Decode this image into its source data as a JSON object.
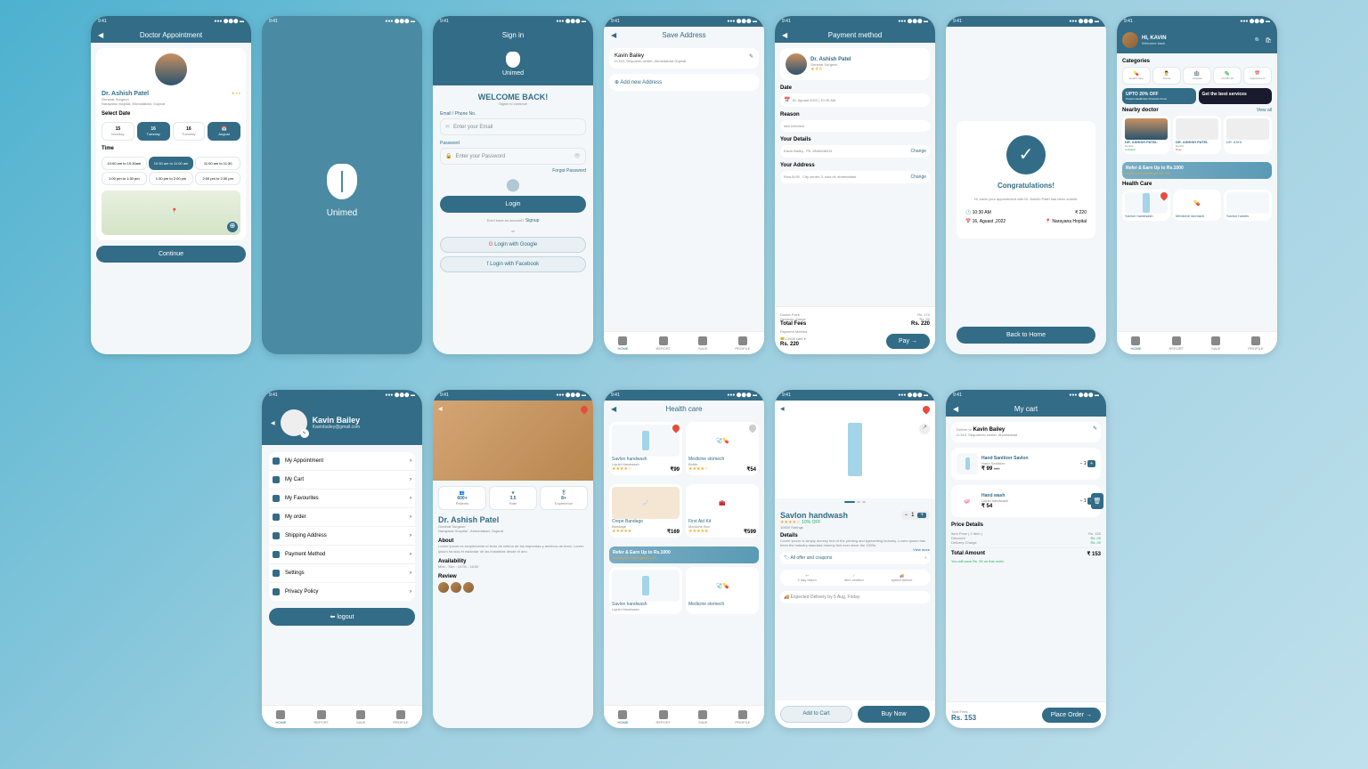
{
  "status": {
    "time": "9:41",
    "sig": "●●● ⬤⬤⬤ ▬"
  },
  "s1": {
    "title": "Doctor Appointment",
    "name": "Dr. Ashish Patel",
    "role": "Genarat Surgeon",
    "loc": "Narayana hospital, Ahmadabad, Gujarat",
    "rate": "★ 4.6",
    "selDate": "Select Date",
    "dates": [
      {
        "d": "15",
        "l": "Monday"
      },
      {
        "d": "16",
        "l": "Tuesday"
      },
      {
        "d": "16",
        "l": "Tuesday"
      },
      {
        "d": "📅",
        "l": "August"
      }
    ],
    "timeLbl": "Time",
    "times": [
      "10:00 am to 10:30am",
      "10:30 am to 11:00 am",
      "11:00 am to 11:30",
      "1:00 pm to 1:30 pm",
      "1:30 pm to 2:00 pm",
      "2:00 pm to 2:30 pm"
    ],
    "cont": "Continue"
  },
  "s2": {
    "brand": "Unimed"
  },
  "s3": {
    "title": "Sign in",
    "brand": "Unimed",
    "welcome": "WELCOME BACK!",
    "sub": "Signin to continue",
    "emailLbl": "Email / Phone No.",
    "emailPh": "Enter your Email",
    "pwLbl": "Password",
    "pwPh": "Enter your Password",
    "forgot": "Forgot Password",
    "login": "Login",
    "noAcc": "Don't have an account?",
    "signup": "Signup",
    "or": "or",
    "google": "Login with Google",
    "fb": "Login with Facebook"
  },
  "s4": {
    "title": "Save Address",
    "name": "Kavin Bailey",
    "addr": "D-310, Sequardo center, Ahmedabad Gujarat",
    "add": "Add new Address"
  },
  "s5": {
    "title": "Payment method",
    "doc": "Dr. Ashish Patel",
    "role": "General Surgeon",
    "dateLbl": "Date",
    "date": "16, Aguast 2022 | 10:30 AM",
    "reasonLbl": "Reason",
    "reason": "skin infection",
    "detLbl": "Your Details",
    "det": "Kavin Bailey , Ph. 8546846231",
    "addrLbl": "Your Address",
    "addr": "Row-B-69 , City center-3, sola rd, ahmedabad",
    "change": "Change",
    "df": "Doctor Fees",
    "dfv": "Rs. 170",
    "sc": "Services charge",
    "scv": "Rs. 50",
    "tf": "Total Fees",
    "tfv": "Rs. 220",
    "pm": "Payment Method",
    "cc": "Credit care",
    "amt": "Rs. 220",
    "pay": "Pay"
  },
  "s6": {
    "cong": "Congratulations!",
    "msg": "Hi, kavin your appointment with Dr. Ashish Patel has been submit.",
    "t1": "10:30 AM",
    "t2": "220",
    "d1": "16, Aguast ,2022",
    "d2": "Narayana Hopital",
    "back": "Back to Home"
  },
  "s7": {
    "hi": "HI, KAVIN",
    "sub": "Welcome back",
    "catLbl": "Categories",
    "cats": [
      "Health Care",
      "Doctor",
      "Hospital",
      "COVID-19",
      "Appointment"
    ],
    "ban1": "UPTO 20% OFF",
    "ban1s": "Protect Healthcare Products Know",
    "ban2": "Get the best services",
    "nearLbl": "Nearby doctor",
    "view": "View all",
    "doc": "DR. ASHISH PATEL",
    "docr": "Dentist",
    "avail": "Available",
    "busy": "Busy",
    "refer": "Refer & Earn Up to Rs.1000",
    "refers": "invite your friend get Rs. 25",
    "hcLbl": "Health Care",
    "p1": "Savlon handwash",
    "p2": "Medicine stomach",
    "p3": "Savlon handw"
  },
  "s8": {
    "name": "Kavin Bailey",
    "email": "Kavinbailey@gmail.com",
    "items": [
      "My Appointment",
      "My Cart",
      "My Favourites",
      "My order",
      "Shipping Address",
      "Payment Method",
      "Settings",
      "Privacy Policy"
    ],
    "logout": "logout"
  },
  "s9": {
    "name": "Dr. Ashish Patel",
    "role": "General Surgeon",
    "loc": "Narayana Hospital , Ahmedabad, Gujarat",
    "st1": "600+",
    "st1l": "Patients",
    "st2": "3.5",
    "st2l": "Rate",
    "st3": "8+",
    "st3l": "Experience",
    "aboutLbl": "About",
    "about": "Lorem ipsum es simplemente el texto de relleno de las imprentas y archivos de texto. Lorem ipsum ha sido el estándar de las industrias desde el ano.",
    "availLbl": "Availability",
    "avail": "Mon - Sun : 10:00 - 16:00",
    "revLbl": "Review"
  },
  "s10": {
    "title": "Health care",
    "p1": "Savlon handwash",
    "p1s": "Liquid Handwash",
    "p1p": "₹99",
    "p2": "Medicine stomech",
    "p2s": "Bottle",
    "p2p": "₹54",
    "p3": "Crepe Bandage",
    "p3s": "Bandage",
    "p3p": "₹169",
    "p4": "First Aid Kit",
    "p4s": "Medicine Box",
    "p4p": "₹599",
    "refer": "Refer & Earn Up to Rs.1000",
    "refers": "invite your friend get Rs. 25",
    "p5": "Savlon handwash",
    "p5s": "Liquid Handwash",
    "p6": "Medicine stomech"
  },
  "s11": {
    "name": "Savlon handwash",
    "rate": "10% OFF",
    "rc": "10600 Ratings",
    "detLbl": "Details",
    "det": "Lorem Ipsum is simply dummy text of the printing and typesetting industry. Lorem Ipsum has been the industry standard dummy text ever since the 1500s.",
    "more": "View more",
    "offer": "All offer and coupons",
    "f1": "2 day return",
    "f2": "item verified",
    "f3": "speed deliver",
    "del": "Expected Delivery by 5 Aug, Friday",
    "add": "Add to Cart",
    "buy": "Buy Now"
  },
  "s12": {
    "title": "My cart",
    "delto": "Deliver to",
    "name": "Kavin Bailey",
    "addr": "D-310, Sequaredo center, Ahmedabad",
    "p1": "Hand Sanitizer Savlon",
    "p1s": "Hand Sanitizer",
    "p1p": "₹ 99",
    "p1o": "160",
    "p2": "Hand wash",
    "p2s": "Liquid handwash",
    "p2p": "₹ 54",
    "pdLbl": "Price Details",
    "l1": "Item Price ( 2 item )",
    "v1": "Rs. 153",
    "l2": "Discount",
    "v2": "Rs. 00",
    "l3": "Delivery Charge",
    "v3": "Rs. 00",
    "l4": "Total Amount",
    "v4": "₹ 153",
    "save": "You will save Rs. 00 on this order",
    "tf": "Total Fees",
    "tfv": "Rs. 153",
    "order": "Place Order"
  },
  "nav": [
    "HOME",
    "REPORT",
    "SAVE",
    "PROFILE"
  ]
}
